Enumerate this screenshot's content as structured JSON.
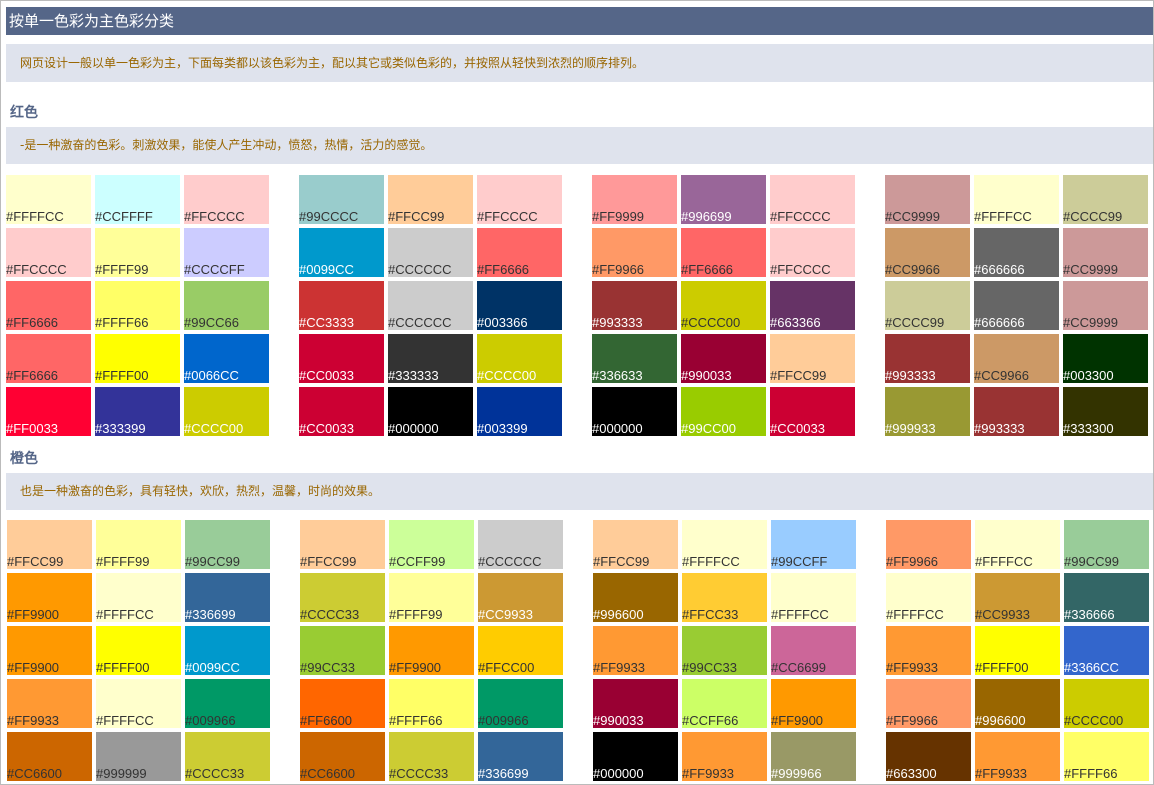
{
  "title": "按单一色彩为主色彩分类",
  "intro": "网页设计一般以单一色彩为主，下面每类都以该色彩为主，配以其它或类似色彩的，并按照从轻快到浓烈的顺序排列。",
  "sections": [
    {
      "heading": "红色",
      "desc": "-是一种激奋的色彩。刺激效果，能使人产生冲动，愤怒，热情，活力的感觉。",
      "groups": [
        [
          [
            "#FFFFCC",
            "#333"
          ],
          [
            "#CCFFFF",
            "#333"
          ],
          [
            "#FFCCCC",
            "#333"
          ],
          [
            "#FFCCCC",
            "#333"
          ],
          [
            "#FFFF99",
            "#333"
          ],
          [
            "#CCCCFF",
            "#333"
          ],
          [
            "#FF6666",
            "#333"
          ],
          [
            "#FFFF66",
            "#333"
          ],
          [
            "#99CC66",
            "#333"
          ],
          [
            "#FF6666",
            "#333"
          ],
          [
            "#FFFF00",
            "#333"
          ],
          [
            "#0066CC",
            "#fff"
          ],
          [
            "#FF0033",
            "#fff"
          ],
          [
            "#333399",
            "#fff"
          ],
          [
            "#CCCC00",
            "#fff"
          ]
        ],
        [
          [
            "#99CCCC",
            "#333"
          ],
          [
            "#FFCC99",
            "#333"
          ],
          [
            "#FFCCCC",
            "#333"
          ],
          [
            "#0099CC",
            "#fff"
          ],
          [
            "#CCCCCC",
            "#333"
          ],
          [
            "#FF6666",
            "#333"
          ],
          [
            "#CC3333",
            "#fff"
          ],
          [
            "#CCCCCC",
            "#333"
          ],
          [
            "#003366",
            "#fff"
          ],
          [
            "#CC0033",
            "#fff"
          ],
          [
            "#333333",
            "#fff"
          ],
          [
            "#CCCC00",
            "#fff"
          ],
          [
            "#CC0033",
            "#fff"
          ],
          [
            "#000000",
            "#fff"
          ],
          [
            "#003399",
            "#fff"
          ]
        ],
        [
          [
            "#FF9999",
            "#333"
          ],
          [
            "#996699",
            "#fff"
          ],
          [
            "#FFCCCC",
            "#333"
          ],
          [
            "#FF9966",
            "#333"
          ],
          [
            "#FF6666",
            "#333"
          ],
          [
            "#FFCCCC",
            "#333"
          ],
          [
            "#993333",
            "#fff"
          ],
          [
            "#CCCC00",
            "#333"
          ],
          [
            "#663366",
            "#fff"
          ],
          [
            "#336633",
            "#fff"
          ],
          [
            "#990033",
            "#fff"
          ],
          [
            "#FFCC99",
            "#333"
          ],
          [
            "#000000",
            "#fff"
          ],
          [
            "#99CC00",
            "#fff"
          ],
          [
            "#CC0033",
            "#fff"
          ]
        ],
        [
          [
            "#CC9999",
            "#333"
          ],
          [
            "#FFFFCC",
            "#333"
          ],
          [
            "#CCCC99",
            "#333"
          ],
          [
            "#CC9966",
            "#333"
          ],
          [
            "#666666",
            "#fff"
          ],
          [
            "#CC9999",
            "#333"
          ],
          [
            "#CCCC99",
            "#333"
          ],
          [
            "#666666",
            "#fff"
          ],
          [
            "#CC9999",
            "#333"
          ],
          [
            "#993333",
            "#fff"
          ],
          [
            "#CC9966",
            "#333"
          ],
          [
            "#003300",
            "#fff"
          ],
          [
            "#999933",
            "#fff"
          ],
          [
            "#993333",
            "#fff"
          ],
          [
            "#333300",
            "#fff"
          ]
        ]
      ]
    },
    {
      "heading": "橙色",
      "desc": "也是一种激奋的色彩，具有轻快，欢欣，热烈，温馨，时尚的效果。",
      "groups": [
        [
          [
            "#FFCC99",
            "#333"
          ],
          [
            "#FFFF99",
            "#333"
          ],
          [
            "#99CC99",
            "#333"
          ],
          [
            "#FF9900",
            "#333"
          ],
          [
            "#FFFFCC",
            "#333"
          ],
          [
            "#336699",
            "#fff"
          ],
          [
            "#FF9900",
            "#333"
          ],
          [
            "#FFFF00",
            "#333"
          ],
          [
            "#0099CC",
            "#fff"
          ],
          [
            "#FF9933",
            "#333"
          ],
          [
            "#FFFFCC",
            "#333"
          ],
          [
            "#009966",
            "#333"
          ],
          [
            "#CC6600",
            "#333"
          ],
          [
            "#999999",
            "#333"
          ],
          [
            "#CCCC33",
            "#333"
          ]
        ],
        [
          [
            "#FFCC99",
            "#333"
          ],
          [
            "#CCFF99",
            "#333"
          ],
          [
            "#CCCCCC",
            "#333"
          ],
          [
            "#CCCC33",
            "#333"
          ],
          [
            "#FFFF99",
            "#333"
          ],
          [
            "#CC9933",
            "#fff"
          ],
          [
            "#99CC33",
            "#333"
          ],
          [
            "#FF9900",
            "#333"
          ],
          [
            "#FFCC00",
            "#333"
          ],
          [
            "#FF6600",
            "#333"
          ],
          [
            "#FFFF66",
            "#333"
          ],
          [
            "#009966",
            "#333"
          ],
          [
            "#CC6600",
            "#333"
          ],
          [
            "#CCCC33",
            "#333"
          ],
          [
            "#336699",
            "#fff"
          ]
        ],
        [
          [
            "#FFCC99",
            "#333"
          ],
          [
            "#FFFFCC",
            "#333"
          ],
          [
            "#99CCFF",
            "#333"
          ],
          [
            "#996600",
            "#fff"
          ],
          [
            "#FFCC33",
            "#333"
          ],
          [
            "#FFFFCC",
            "#333"
          ],
          [
            "#FF9933",
            "#333"
          ],
          [
            "#99CC33",
            "#333"
          ],
          [
            "#CC6699",
            "#333"
          ],
          [
            "#990033",
            "#fff"
          ],
          [
            "#CCFF66",
            "#333"
          ],
          [
            "#FF9900",
            "#333"
          ],
          [
            "#000000",
            "#fff"
          ],
          [
            "#FF9933",
            "#333"
          ],
          [
            "#999966",
            "#fff"
          ]
        ],
        [
          [
            "#FF9966",
            "#333"
          ],
          [
            "#FFFFCC",
            "#333"
          ],
          [
            "#99CC99",
            "#333"
          ],
          [
            "#FFFFCC",
            "#333"
          ],
          [
            "#CC9933",
            "#333"
          ],
          [
            "#336666",
            "#fff"
          ],
          [
            "#FF9933",
            "#333"
          ],
          [
            "#FFFF00",
            "#333"
          ],
          [
            "#3366CC",
            "#fff"
          ],
          [
            "#FF9966",
            "#333"
          ],
          [
            "#996600",
            "#fff"
          ],
          [
            "#CCCC00",
            "#333"
          ],
          [
            "#663300",
            "#fff"
          ],
          [
            "#FF9933",
            "#333"
          ],
          [
            "#FFFF66",
            "#333"
          ]
        ]
      ]
    }
  ]
}
